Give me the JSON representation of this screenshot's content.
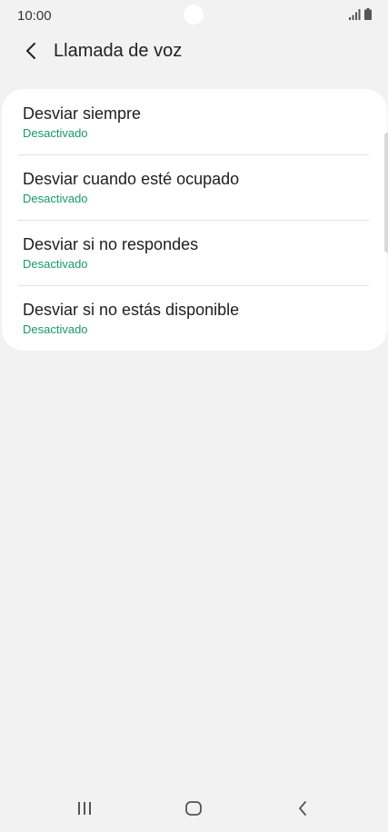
{
  "status_bar": {
    "time": "10:00",
    "icons": [
      "signal-icon",
      "battery-icon"
    ]
  },
  "app_bar": {
    "back_icon": "chevron-left-icon",
    "title": "Llamada de voz"
  },
  "items": [
    {
      "title": "Desviar siempre",
      "status": "Desactivado"
    },
    {
      "title": "Desviar cuando esté ocupado",
      "status": "Desactivado"
    },
    {
      "title": "Desviar si no respondes",
      "status": "Desactivado"
    },
    {
      "title": "Desviar si no estás disponible",
      "status": "Desactivado"
    }
  ],
  "nav_bar": {
    "icons": [
      "recents-icon",
      "home-icon",
      "back-icon"
    ]
  },
  "colors": {
    "background": "#f2f2f2",
    "card": "#ffffff",
    "status_green": "#17996a",
    "text": "#1e1e1e"
  }
}
